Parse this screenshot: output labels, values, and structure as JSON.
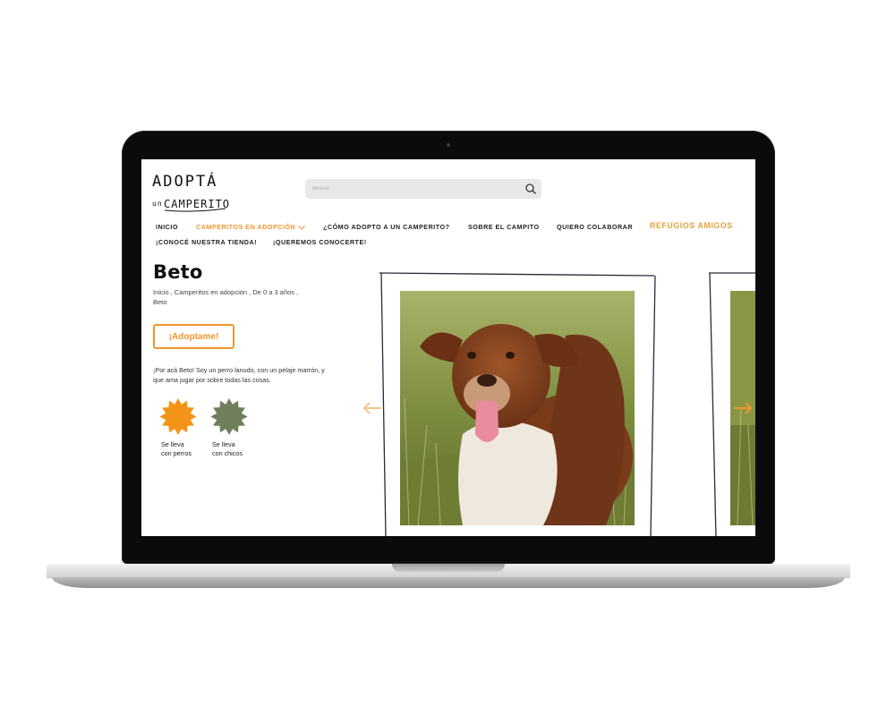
{
  "search": {
    "placeholder": "Buscar"
  },
  "nav": {
    "items": [
      {
        "label": "INICIO"
      },
      {
        "label": "CAMPERITOS EN ADOPCIÓN"
      },
      {
        "label": "¿CÓMO ADOPTO A UN CAMPERITO?"
      },
      {
        "label": "SOBRE EL CAMPITO"
      },
      {
        "label": "QUIERO COLABORAR"
      },
      {
        "label": "REFUGIOS AMIGOS"
      },
      {
        "label": "¡CONOCÉ NUESTRA TIENDA!"
      },
      {
        "label": "¡QUEREMOS CONOCERTE!"
      }
    ]
  },
  "logo": {
    "line1": "ADOPTÁ",
    "line2_small": "un",
    "line2": "CAMPERITO"
  },
  "dog": {
    "name": "Beto",
    "breadcrumb": [
      "Inicio",
      "Camperitos en adopción",
      "De 0 a 3 años",
      "Beto"
    ],
    "adopt_label": "¡Adoptame!",
    "description": "¡Por acá Beto! Soy un perro lanudo, con un pelaje marrón, y que ama jugar por sobre todas las cosas.",
    "traits": [
      {
        "line1": "Se lleva",
        "line2": "con perros",
        "color": "#f39417",
        "icon": "sun-badge-icon"
      },
      {
        "line1": "Se lleva",
        "line2": "con chicos",
        "color": "#6f7f5c",
        "icon": "sun-badge-icon"
      }
    ]
  },
  "colors": {
    "accent": "#f0962c",
    "refugios": "#e5a23a",
    "search_bg": "#e8e8e8"
  }
}
